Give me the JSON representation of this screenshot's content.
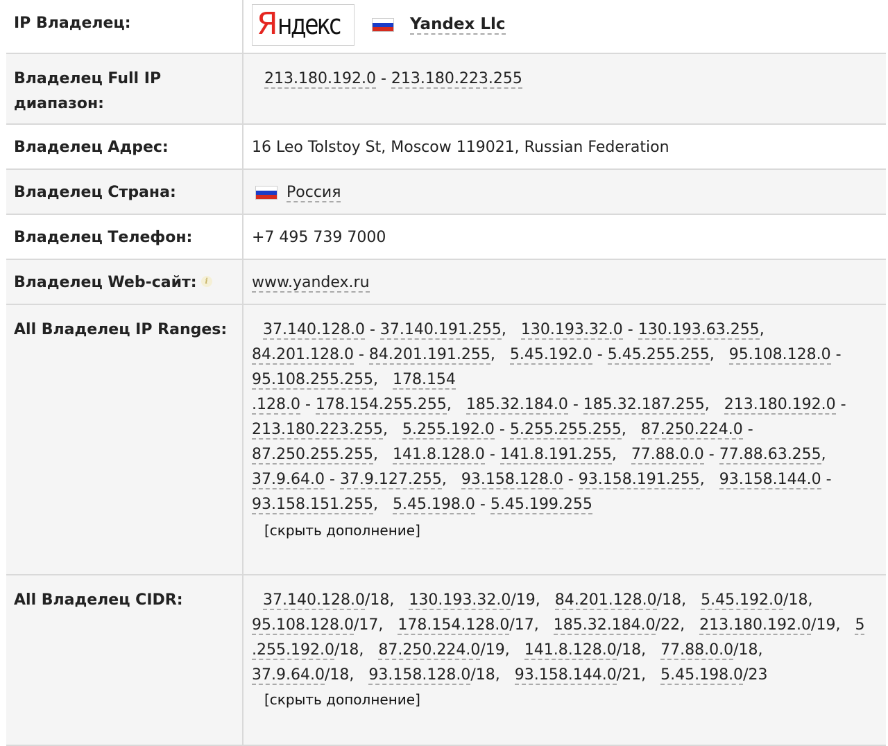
{
  "rows": {
    "owner": {
      "label": "IP Владелец:",
      "logo": {
        "first": "Я",
        "rest": "ндекс"
      },
      "name": "Yandex Llc",
      "flag_icon": "russia-flag-icon"
    },
    "full_range": {
      "label": "Владелец Full IP диапазон:",
      "start": "213.180.192.0",
      "end": "213.180.223.255"
    },
    "address": {
      "label": "Владелец Адрес:",
      "value": "16 Leo Tolstoy St, Moscow 119021, Russian Federation"
    },
    "country": {
      "label": "Владелец Страна:",
      "value": "Россия"
    },
    "phone": {
      "label": "Владелец Телефон:",
      "value": "+7 495 739 7000"
    },
    "website": {
      "label": "Владелец Web-сайт:",
      "value": "www.yandex.ru",
      "info_icon": "i"
    },
    "ranges": {
      "label": "All Владелец IP Ranges:",
      "items": [
        [
          "37.140.128.0",
          "37.140.191.255"
        ],
        [
          "130.193.32.0",
          "130.193.63.255"
        ],
        [
          "84.201.128.0",
          "84.201.191.255"
        ],
        [
          "5.45.192.0",
          "5.45.255.255"
        ],
        [
          "95.108.128.0",
          "95.108.255.255"
        ],
        [
          "178.154",
          ".128.0",
          "178.154.255.255"
        ],
        [
          "185.32.184.0",
          "185.32.187.255"
        ],
        [
          "213.180.192.0",
          "213.180.223.255"
        ],
        [
          "5.255.192.0",
          "5.255.255.255"
        ],
        [
          "87.250.224.0",
          "87.250.255.255"
        ],
        [
          "141.8.128.0",
          "141.8.191.255"
        ],
        [
          "77.88.0.0",
          "77.88.63.255"
        ],
        [
          "37.9.64.0",
          "37.9.127.255"
        ],
        [
          "93.158.128.0",
          "93.158.191.255"
        ],
        [
          "93.158.144.0",
          "93.158.151.255"
        ],
        [
          "5.45.198.0",
          "5.45.199.255"
        ]
      ],
      "toggle": "[скрыть дополнение]"
    },
    "cidr": {
      "label": "All Владелец CIDR:",
      "items": [
        [
          "37.140.128.0",
          "/18"
        ],
        [
          "130.193.32.0",
          "/19"
        ],
        [
          "84.201.128.0",
          "/18"
        ],
        [
          "5.45.192.0",
          "/18"
        ],
        [
          "95.108.128.0",
          "/17"
        ],
        [
          "178.154.128.0",
          "/17"
        ],
        [
          "185.32.184.0",
          "/22"
        ],
        [
          "213.180.192.0",
          "/19"
        ],
        [
          "5",
          ".255.192.0",
          "/18"
        ],
        [
          "87.250.224.0",
          "/19"
        ],
        [
          "141.8.128.0",
          "/18"
        ],
        [
          "77.88.0.0",
          "/18"
        ],
        [
          "37.9.64.0",
          "/18"
        ],
        [
          "93.158.128.0",
          "/18"
        ],
        [
          "93.158.144.0",
          "/21"
        ],
        [
          "5.45.198.0",
          "/23"
        ]
      ],
      "toggle": "[скрыть дополнение]"
    }
  }
}
